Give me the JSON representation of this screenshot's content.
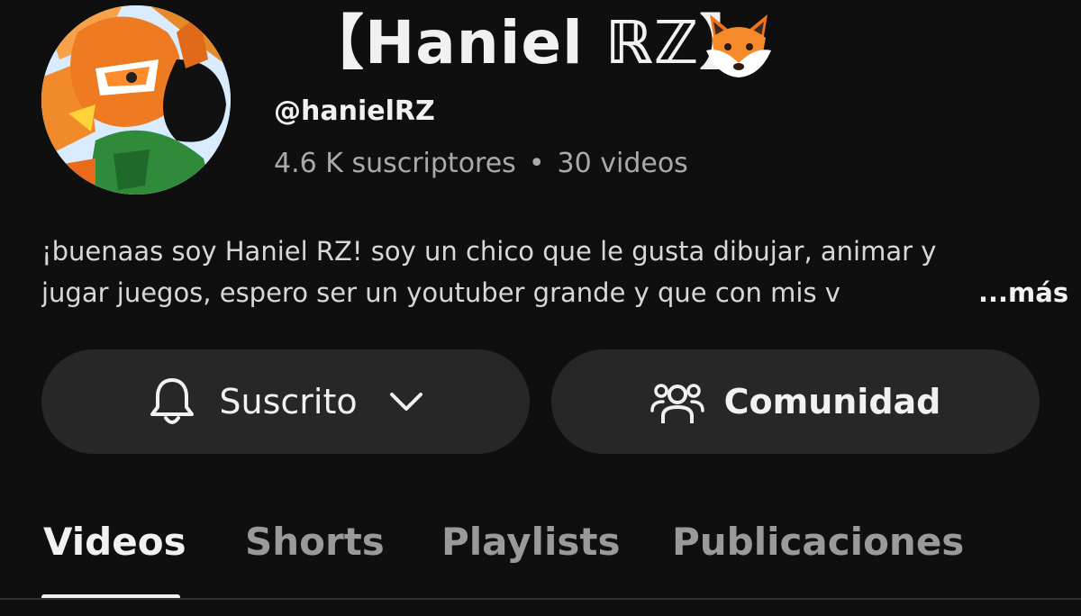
{
  "channel": {
    "title": "【Haniel ℝℤ】",
    "handle": "@hanielRZ",
    "subscribers": "4.6 K suscriptores",
    "separator": "•",
    "videos_count": "30 videos",
    "description_line1": "¡buenaas soy Haniel RZ! soy un chico que le gusta dibujar, animar y",
    "description_line2": "jugar juegos, espero ser un youtuber grande y que con mis v",
    "more_label": "...más"
  },
  "actions": {
    "subscribed_label": "Suscrito",
    "community_label": "Comunidad"
  },
  "tabs": [
    {
      "label": "Videos",
      "active": true
    },
    {
      "label": "Shorts",
      "active": false
    },
    {
      "label": "Playlists",
      "active": false
    },
    {
      "label": "Publicaciones",
      "active": false
    }
  ],
  "icons": {
    "avatar": "channel-avatar",
    "emoji": "fox-face-icon",
    "subscribe": "bell-icon",
    "dropdown": "chevron-down-icon",
    "community": "people-icon"
  },
  "colors": {
    "background": "#0f0f0f",
    "button": "#272727",
    "secondary_text": "#aaaaaa",
    "inactive_tab": "#9a9a9a"
  }
}
